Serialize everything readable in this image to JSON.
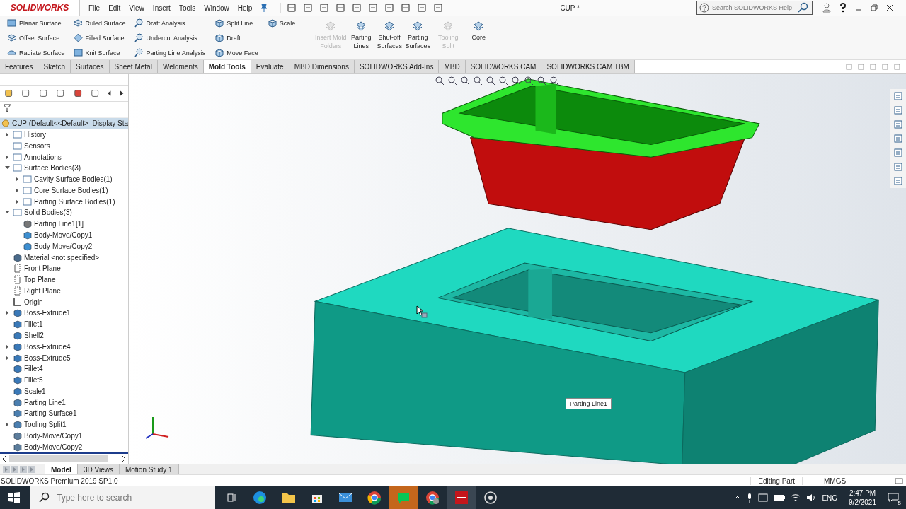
{
  "app": {
    "logo": "SOLIDWORKS",
    "menu": [
      "File",
      "Edit",
      "View",
      "Insert",
      "Tools",
      "Window",
      "Help"
    ],
    "document_title": "CUP *",
    "search": {
      "placeholder": "Search SOLIDWORKS Help"
    }
  },
  "ribbon": {
    "columns": [
      [
        "Planar Surface",
        "Offset Surface",
        "Radiate Surface"
      ],
      [
        "Ruled Surface",
        "Filled Surface",
        "Knit Surface"
      ],
      [
        "Draft Analysis",
        "Undercut Analysis",
        "Parting Line Analysis"
      ],
      [
        "Split Line",
        "Draft",
        "Move Face"
      ],
      [
        "Scale"
      ]
    ],
    "big_buttons": [
      {
        "label": "Insert Mold Folders",
        "disabled": true
      },
      {
        "label": "Parting Lines",
        "disabled": false
      },
      {
        "label": "Shut-off Surfaces",
        "disabled": false
      },
      {
        "label": "Parting Surfaces",
        "disabled": false
      },
      {
        "label": "Tooling Split",
        "disabled": true
      },
      {
        "label": "Core",
        "disabled": false
      }
    ]
  },
  "tabs": [
    {
      "label": "Features",
      "selected": false
    },
    {
      "label": "Sketch",
      "selected": false
    },
    {
      "label": "Surfaces",
      "selected": false
    },
    {
      "label": "Sheet Metal",
      "selected": false
    },
    {
      "label": "Weldments",
      "selected": false
    },
    {
      "label": "Mold Tools",
      "selected": true
    },
    {
      "label": "Evaluate",
      "selected": false
    },
    {
      "label": "MBD Dimensions",
      "selected": false
    },
    {
      "label": "SOLIDWORKS Add-Ins",
      "selected": false
    },
    {
      "label": "MBD",
      "selected": false
    },
    {
      "label": "SOLIDWORKS CAM",
      "selected": false
    },
    {
      "label": "SOLIDWORKS CAM TBM",
      "selected": false
    }
  ],
  "tree": {
    "root": "CUP  (Default<<Default>_Display Sta",
    "items": [
      {
        "label": "History",
        "expanded": false,
        "kind": "folder"
      },
      {
        "label": "Sensors",
        "kind": "folder"
      },
      {
        "label": "Annotations",
        "expanded": false,
        "kind": "folder"
      },
      {
        "label": "Surface Bodies(3)",
        "expanded": true,
        "kind": "folder",
        "children": [
          {
            "label": "Cavity Surface Bodies(1)",
            "expanded": false,
            "kind": "folder"
          },
          {
            "label": "Core Surface Bodies(1)",
            "expanded": false,
            "kind": "folder"
          },
          {
            "label": "Parting Surface Bodies(1)",
            "expanded": false,
            "kind": "folder"
          }
        ]
      },
      {
        "label": "Solid Bodies(3)",
        "expanded": true,
        "kind": "folder",
        "children": [
          {
            "label": "Parting Line1[1]",
            "kind": "wire"
          },
          {
            "label": "Body-Move/Copy1",
            "kind": "solid"
          },
          {
            "label": "Body-Move/Copy2",
            "kind": "solid"
          }
        ]
      },
      {
        "label": "Material <not specified>",
        "kind": "material"
      },
      {
        "label": "Front Plane",
        "kind": "plane"
      },
      {
        "label": "Top Plane",
        "kind": "plane"
      },
      {
        "label": "Right Plane",
        "kind": "plane"
      },
      {
        "label": "Origin",
        "kind": "origin"
      },
      {
        "label": "Boss-Extrude1",
        "expanded": false,
        "kind": "feature"
      },
      {
        "label": "Fillet1",
        "kind": "feature"
      },
      {
        "label": "Shell2",
        "kind": "feature"
      },
      {
        "label": "Boss-Extrude4",
        "expanded": false,
        "kind": "feature"
      },
      {
        "label": "Boss-Extrude5",
        "expanded": false,
        "kind": "feature"
      },
      {
        "label": "Fillet4",
        "kind": "feature"
      },
      {
        "label": "Fillet5",
        "kind": "feature"
      },
      {
        "label": "Scale1",
        "kind": "feature"
      },
      {
        "label": "Parting Line1",
        "kind": "split"
      },
      {
        "label": "Parting Surface1",
        "kind": "split"
      },
      {
        "label": "Tooling Split1",
        "expanded": false,
        "kind": "split"
      },
      {
        "label": "Body-Move/Copy1",
        "kind": "move"
      },
      {
        "label": "Body-Move/Copy2",
        "kind": "move"
      }
    ]
  },
  "viewport": {
    "callout": "Parting Line1"
  },
  "bottom_tabs": [
    {
      "label": "Model",
      "selected": true
    },
    {
      "label": "3D Views",
      "selected": false
    },
    {
      "label": "Motion Study 1",
      "selected": false
    }
  ],
  "status_bar": {
    "product": "SOLIDWORKS Premium 2019 SP1.0",
    "mode": "Editing Part",
    "units": "MMGS"
  },
  "taskbar": {
    "search": {
      "placeholder": "Type here to search"
    },
    "language": "ENG",
    "time": "2:47 PM",
    "date": "9/2/2021",
    "notifications": "5"
  }
}
